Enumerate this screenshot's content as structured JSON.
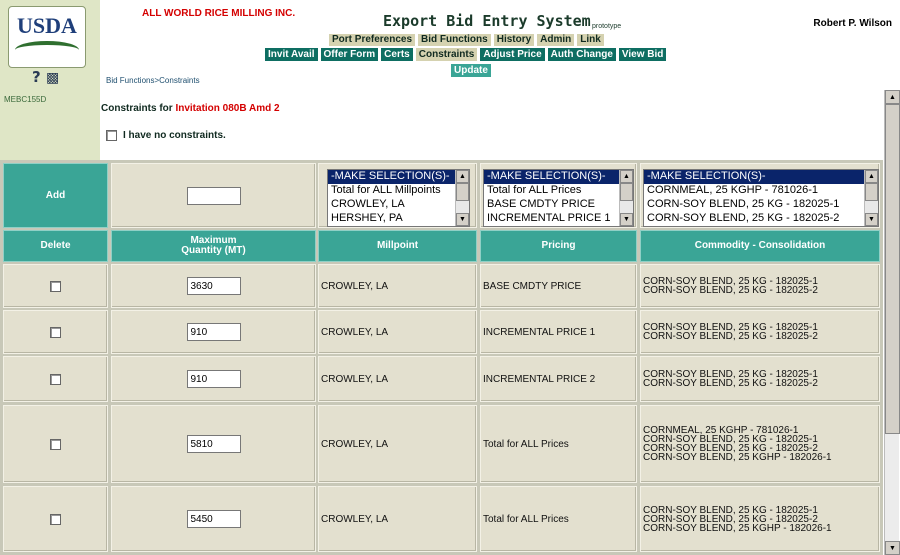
{
  "branding": {
    "logo_text": "USDA",
    "help_icons_text": "?",
    "page_code": "MEBC155D",
    "company": "ALL WORLD RICE MILLING INC.",
    "system_name": "Export Bid Entry System",
    "system_tag": "prototype",
    "user_name": "Robert P. Wilson"
  },
  "nav": {
    "primary": [
      "Port Preferences",
      "Bid Functions",
      "History",
      "Admin",
      "Link"
    ],
    "secondary": [
      "Invit Avail",
      "Offer Form",
      "Certs",
      "Constraints",
      "Adjust Price",
      "Auth Change",
      "View Bid"
    ],
    "active_secondary": "Constraints",
    "update_label": "Update"
  },
  "breadcrumb": "Bid Functions>Constraints",
  "constraints": {
    "title_prefix": "Constraints for ",
    "invitation": "Invitation 080B Amd 2",
    "no_constraints_label": "I have no constraints."
  },
  "add_row": {
    "label": "Add",
    "qty_value": "",
    "millpoint_options": [
      "-MAKE SELECTION(S)-",
      "Total for ALL Millpoints",
      "CROWLEY, LA",
      "HERSHEY, PA"
    ],
    "pricing_options": [
      "-MAKE SELECTION(S)-",
      "Total for ALL Prices",
      "BASE CMDTY PRICE",
      "INCREMENTAL PRICE 1"
    ],
    "commodity_options": [
      "-MAKE SELECTION(S)-",
      "CORNMEAL, 25 KGHP - 781026-1",
      "CORN-SOY BLEND, 25 KG - 182025-1",
      "CORN-SOY BLEND, 25 KG - 182025-2"
    ]
  },
  "headers": {
    "delete": "Delete",
    "max_qty_line1": "Maximum",
    "max_qty_line2": "Quantity (MT)",
    "millpoint": "Millpoint",
    "pricing": "Pricing",
    "commodity": "Commodity - Consolidation"
  },
  "rows": [
    {
      "qty": "3630",
      "millpoint": "CROWLEY, LA",
      "pricing": "BASE CMDTY PRICE",
      "commodities": [
        "CORN-SOY BLEND, 25 KG - 182025-1",
        "CORN-SOY BLEND, 25 KG - 182025-2"
      ]
    },
    {
      "qty": "910",
      "millpoint": "CROWLEY, LA",
      "pricing": "INCREMENTAL PRICE 1",
      "commodities": [
        "CORN-SOY BLEND, 25 KG - 182025-1",
        "CORN-SOY BLEND, 25 KG - 182025-2"
      ]
    },
    {
      "qty": "910",
      "millpoint": "CROWLEY, LA",
      "pricing": "INCREMENTAL PRICE 2",
      "commodities": [
        "CORN-SOY BLEND, 25 KG - 182025-1",
        "CORN-SOY BLEND, 25 KG - 182025-2"
      ]
    },
    {
      "qty": "5810",
      "millpoint": "CROWLEY, LA",
      "pricing": "Total for ALL Prices",
      "commodities": [
        "CORNMEAL, 25 KGHP - 781026-1",
        "CORN-SOY BLEND, 25 KG - 182025-1",
        "CORN-SOY BLEND, 25 KG - 182025-2",
        "CORN-SOY BLEND, 25 KGHP - 182026-1"
      ]
    },
    {
      "qty": "5450",
      "millpoint": "CROWLEY, LA",
      "pricing": "Total for ALL Prices",
      "commodities": [
        "CORN-SOY BLEND, 25 KG - 182025-1",
        "CORN-SOY BLEND, 25 KG - 182025-2",
        "CORN-SOY BLEND, 25 KGHP - 182026-1"
      ]
    }
  ],
  "colors": {
    "teal": "#3aa596",
    "nav_dark": "#0e6e62",
    "accent_red": "#d40000",
    "sidebar": "#dfe6c6"
  }
}
